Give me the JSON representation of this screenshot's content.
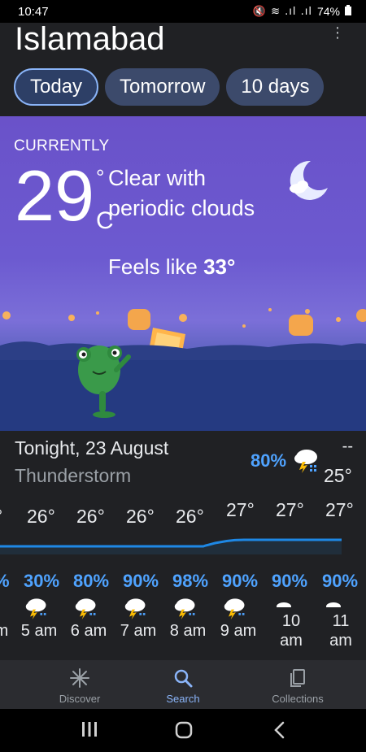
{
  "status": {
    "time": "10:47",
    "battery": "74%",
    "icons": "🔇 ≋ .ıl .ıl"
  },
  "header": {
    "city": "Islamabad",
    "more_icon": "⋮"
  },
  "tabs": [
    {
      "label": "Today",
      "active": true
    },
    {
      "label": "Tomorrow",
      "active": false
    },
    {
      "label": "10 days",
      "active": false
    }
  ],
  "current": {
    "heading": "CURRENTLY",
    "temp": "29",
    "degree": "°",
    "unit": "C",
    "condition": "Clear with periodic clouds",
    "feels_prefix": "Feels like",
    "feels_value": "33°",
    "icon": "moon-cloud-icon"
  },
  "tonight": {
    "title": "Tonight, 23 August",
    "condition": "Thunderstorm",
    "high": "--",
    "precip": "80%",
    "low": "25°",
    "icon": "thunderstorm-icon"
  },
  "hourly": {
    "temps": [
      "°",
      "26°",
      "26°",
      "26°",
      "26°",
      "27°",
      "27°",
      "27°"
    ],
    "precip": [
      "%",
      "30%",
      "80%",
      "90%",
      "98%",
      "90%",
      "90%",
      "90%"
    ],
    "labels": [
      "m",
      "5 am",
      "6 am",
      "7 am",
      "8 am",
      "9 am",
      "10 am",
      "11 am"
    ]
  },
  "nav": [
    {
      "label": "Discover",
      "icon": "asterisk-icon",
      "active": false
    },
    {
      "label": "Search",
      "icon": "search-icon",
      "active": true
    },
    {
      "label": "Collections",
      "icon": "collections-icon",
      "active": false
    }
  ],
  "colors": {
    "accent": "#8ab4f8",
    "precip": "#4fa3ff",
    "sky": "#6a52c9"
  }
}
